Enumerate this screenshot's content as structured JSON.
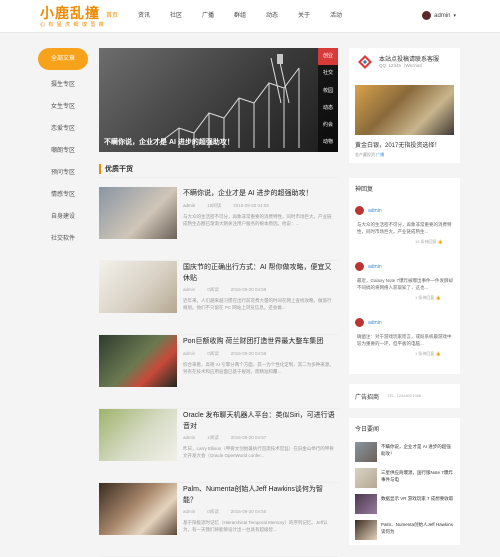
{
  "header": {
    "logo": "小鹿乱撞",
    "logo_sub": "心 有 猛 虎 细 嗅 蔷 薇",
    "nav": [
      "首页",
      "资讯",
      "社区",
      "广播",
      "群组",
      "动态",
      "关于",
      "活动"
    ],
    "active_nav": "首页",
    "user": "admin"
  },
  "sidebar": {
    "items": [
      "全部文章",
      "摄生专区",
      "女生专区",
      "恋爱专区",
      "嘲朗专区",
      "预问专区",
      "情感专区",
      "自身建设",
      "社交软件"
    ],
    "active": "全部文章"
  },
  "hero": {
    "title": "不瞒你说，企业才是 AI 进步的超强助攻！",
    "tabs": [
      "创业",
      "社交",
      "校园",
      "动态",
      "约会",
      "动物"
    ],
    "active_tab": "创业"
  },
  "section": {
    "title": "优质干货"
  },
  "articles": [
    {
      "title": "不瞒你说，企业才是 AI 进步的超强助攻！",
      "author": "admin",
      "views": "19阅读",
      "date": "2016-09-20 04:59",
      "desc": "与大众的生活密不可分，再象非常重要的消费特性，同时市场巨大。产业链成熟生态圈已渐渐大刚关注用户服务的根本原因。他说：..."
    },
    {
      "title": "国庆节的正确出行方式：AI 帮你做攻略，便宜又休贴",
      "author": "admin",
      "views": "0阅读",
      "date": "2016-09-20 04:59",
      "desc": "近年来，人们越来越习惯在出行前花费大量的时间在网上查找攻略，做旅行规划。他们不只留在 PC 网站上浏览信息，还会做..."
    },
    {
      "title": "Pon巨额收购 荷兰财团打造世界最大整车集团",
      "author": "admin",
      "views": "0阅读",
      "date": "2016-09-20 04:58",
      "desc": "综合来看，高德 AI 引擎分两个方面，其一为个性化定制，其二为多种来源。另有在技术和应用层面已基于规则，而精准和覆..."
    },
    {
      "title": "Oracle 发布聊天机器人平台：类似Siri，可进行语音对",
      "author": "admin",
      "views": "1阅读",
      "date": "2016-09-20 04:57",
      "desc": "昨日，Larry Ellison（甲骨文创始兼执行首席技术官监）在旧金山举行的甲骨文开发大会（Oracle OpenWorld confer..."
    },
    {
      "title": "Palm、Numenta创始人Jeff Hawkins谈何为智能？",
      "author": "admin",
      "views": "0阅读",
      "date": "2016-09-20 04:55",
      "desc": "基于阳极流时记忆（Hierarchical Temporal Memory）的序列记忆。Jeff认为，有一天我们将能够设计出一台具有超级智..."
    }
  ],
  "right_top": {
    "name": "本站点投稿请联系客服",
    "qq": "QQ: 12345（Wechat）",
    "caption": "黄金白银，2017无指投资选择！",
    "tag_prefix": "金产藏投资",
    "tag": "广播"
  },
  "comments": {
    "title": "神回复",
    "items": [
      {
        "user": "admin",
        "text": "与大众的生活密不可分，再象非常重要的消费特性，同时市场巨大。产业链成熟生...",
        "foot": "15 条神回复"
      },
      {
        "user": "admin",
        "text": "最近，Galaxy Note 7爆炸被曝出事件一件发酵却不同搞的将网络人获取知了，这也...",
        "foot": "1 条神回复"
      },
      {
        "user": "admin",
        "text": "确凿注：对于游戏玩家而言，或既系统最游戏中较为重要的一环，但平板的电脑...",
        "foot": "1 条神回复"
      }
    ]
  },
  "ad": {
    "title": "广告招商",
    "phone": "TEL: 12345021988"
  },
  "today": {
    "title": "今日要闻",
    "items": [
      "不瞒你说，企业才是 AI 进步的超强助攻！",
      "三星供应商爆源，国行版Note 7爆炸事件与电",
      "数据显示 VR 游戏玩家 7 成想要收取",
      "Palm、Numenta创始人Jeff Hawkins谈何为"
    ]
  }
}
